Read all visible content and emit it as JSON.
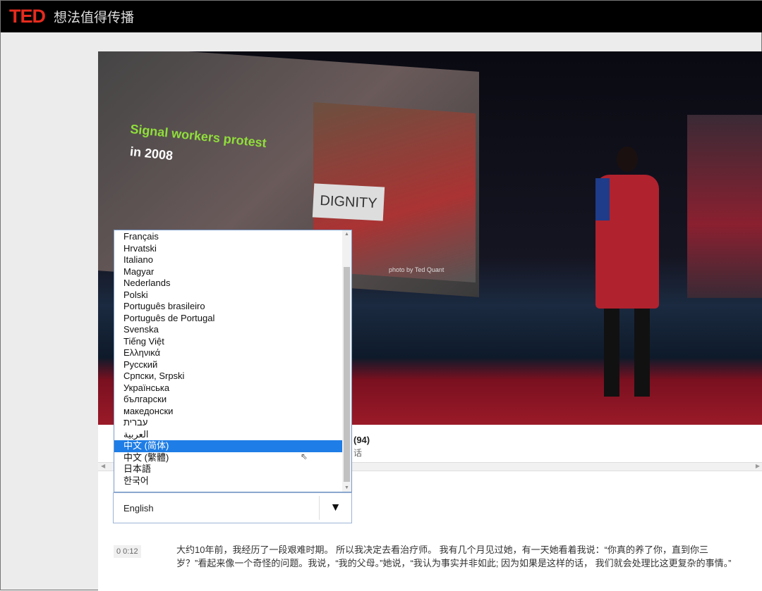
{
  "header": {
    "logo": "TED",
    "slogan": "想法值得传播"
  },
  "video": {
    "overlay_line1": "Signal workers protest",
    "overlay_line2": "in 2008",
    "sign_text": "DIGNITY",
    "photo_credit": "photo by Ted Quant"
  },
  "meta": {
    "count": "(94)",
    "sub": "话"
  },
  "language_list": {
    "items": [
      "Français",
      "Hrvatski",
      "Italiano",
      "Magyar",
      "Nederlands",
      "Polski",
      "Português brasileiro",
      "Português de Portugal",
      "Svenska",
      "Tiếng Việt",
      "Ελληνικά",
      "Русский",
      "Српски, Srpski",
      "Українська",
      "български",
      "македонски",
      "עברית",
      "العربية",
      "中文 (简体)",
      "中文 (繁體)",
      "日本語",
      "한국어"
    ],
    "selected": "中文 (简体)"
  },
  "language_select": {
    "value": "English"
  },
  "transcript": {
    "timestamp": "0 0:12",
    "text": "大约10年前，我经历了一段艰难时期。 所以我决定去看治疗师。 我有几个月见过她，有一天她看着我说：“你真的养了你，直到你三岁？”看起来像一个奇怪的问题。我说，“我的父母。”她说，“我认为事实并非如此; 因为如果是这样的话， 我们就会处理比这更复杂的事情。”"
  },
  "colors": {
    "brand": "#e62b1e",
    "selection": "#1e7de6"
  }
}
